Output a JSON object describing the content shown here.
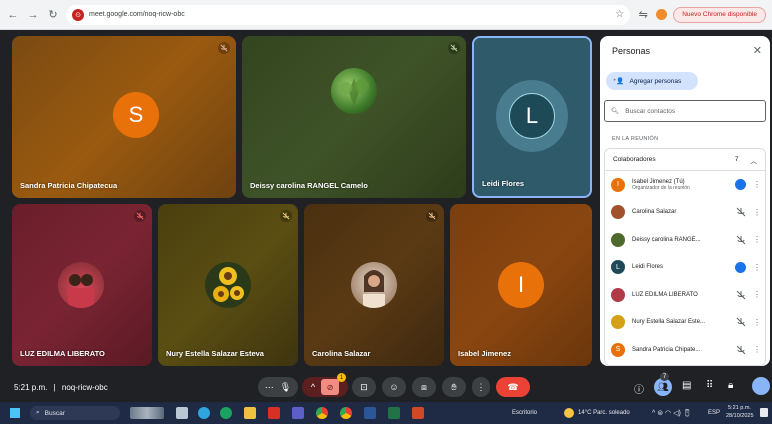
{
  "browser": {
    "url": "meet.google.com/noq-ricw-obc",
    "update_label": "Nuevo Chrome disponible"
  },
  "tiles": [
    {
      "name": "Sandra Patricia Chipatecua",
      "letter": "S"
    },
    {
      "name": "Deissy carolina RANGEL Camelo"
    },
    {
      "name": "Leidi Flores",
      "letter": "L"
    },
    {
      "name": "LUZ EDILMA LIBERATO"
    },
    {
      "name": "Nury Estella Salazar Esteva"
    },
    {
      "name": "Carolina Salazar"
    },
    {
      "name": "Isabel Jimenez",
      "letter": "I"
    }
  ],
  "meeting": {
    "time": "5:21 p.m.",
    "separator": "|",
    "code": "noq-ricw-obc",
    "reactions_badge": "1",
    "people_count_badge": "7"
  },
  "panel": {
    "title": "Personas",
    "add_label": "Agregar personas",
    "search_placeholder": "Buscar contactos",
    "section_label": "EN LA REUNIÓN",
    "group_label": "Colaboradores",
    "group_count": "7",
    "people": [
      {
        "name": "Isabel Jimenez (Tú)",
        "sub": "Organizador de la reunión",
        "letter": "I",
        "color": "#e8710a"
      },
      {
        "name": "Carolina Salazar",
        "color": "#a0522d"
      },
      {
        "name": "Deissy carolina RANGE...",
        "color": "#4e6b2e"
      },
      {
        "name": "Leidi Flores",
        "letter": "L",
        "color": "#1e6f7a"
      },
      {
        "name": "LUZ EDILMA LIBERATO",
        "color": "#b03a48"
      },
      {
        "name": "Nury Estella Salazar Este...",
        "color": "#d4a017"
      },
      {
        "name": "Sandra Patricia Chipate...",
        "letter": "S",
        "color": "#e8710a"
      }
    ]
  },
  "taskbar": {
    "search_label": "Buscar",
    "weather": "14°C Parc. soleado",
    "lang": "ESP",
    "clock_time": "5:21 p.m.",
    "clock_date": "28/10/2025",
    "desktop": "Escritorio"
  }
}
